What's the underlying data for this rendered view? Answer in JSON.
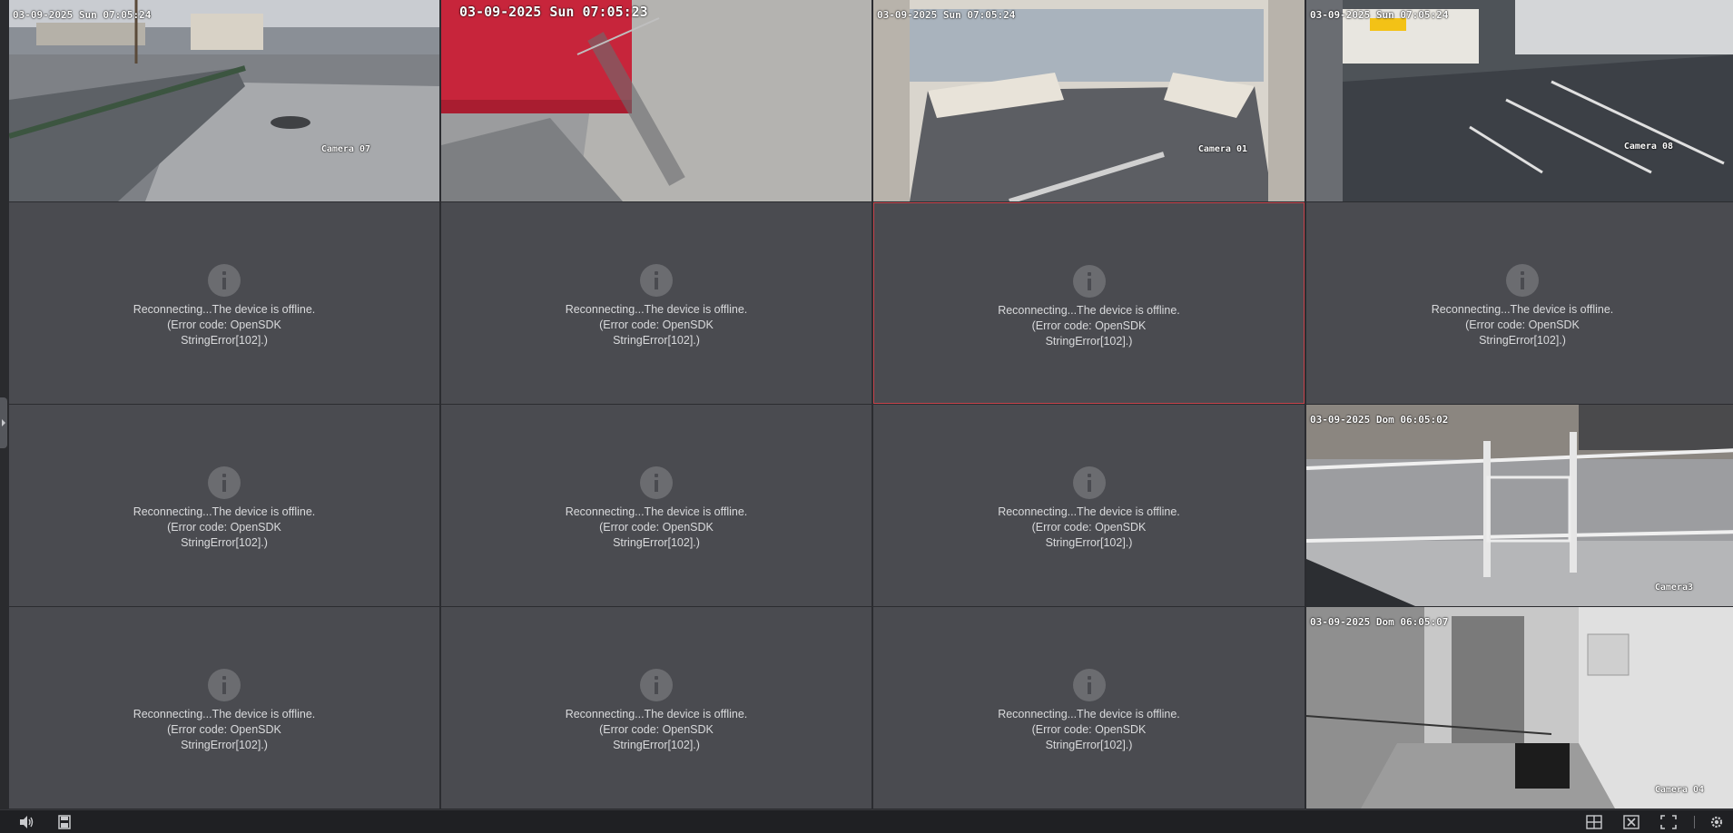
{
  "offline_message": "Reconnecting...The device is offline.\n(Error code: OpenSDK\nStringError[102].)",
  "feeds": {
    "cam07": {
      "timestamp": "03-09-2025 Sun 07:05:24",
      "label": "Camera 07"
    },
    "container": {
      "timestamp": "03-09-2025 Sun 07:05:23"
    },
    "cam01": {
      "timestamp": "03-09-2025 Sun 07:05:24",
      "label": "Camera 01"
    },
    "cam08": {
      "timestamp": "03-09-2025 Sun 07:05:24",
      "label": "Camera 08"
    },
    "cam3": {
      "timestamp": "03-09-2025 Dom 06:05:02",
      "label": "Camera3"
    },
    "cam04": {
      "timestamp": "03-09-2025 Dom 06:05:07",
      "label": "Camera 04"
    }
  },
  "toolbar": {
    "left_icons": [
      "speaker-icon",
      "save-icon"
    ],
    "right_icons": [
      "layout-grid-icon",
      "close-all-icon",
      "fullscreen-icon",
      "settings-icon"
    ]
  },
  "colors": {
    "tile_bg": "#4a4b50",
    "selected_border": "#c8434b",
    "toolbar_bg": "#1f2023"
  }
}
